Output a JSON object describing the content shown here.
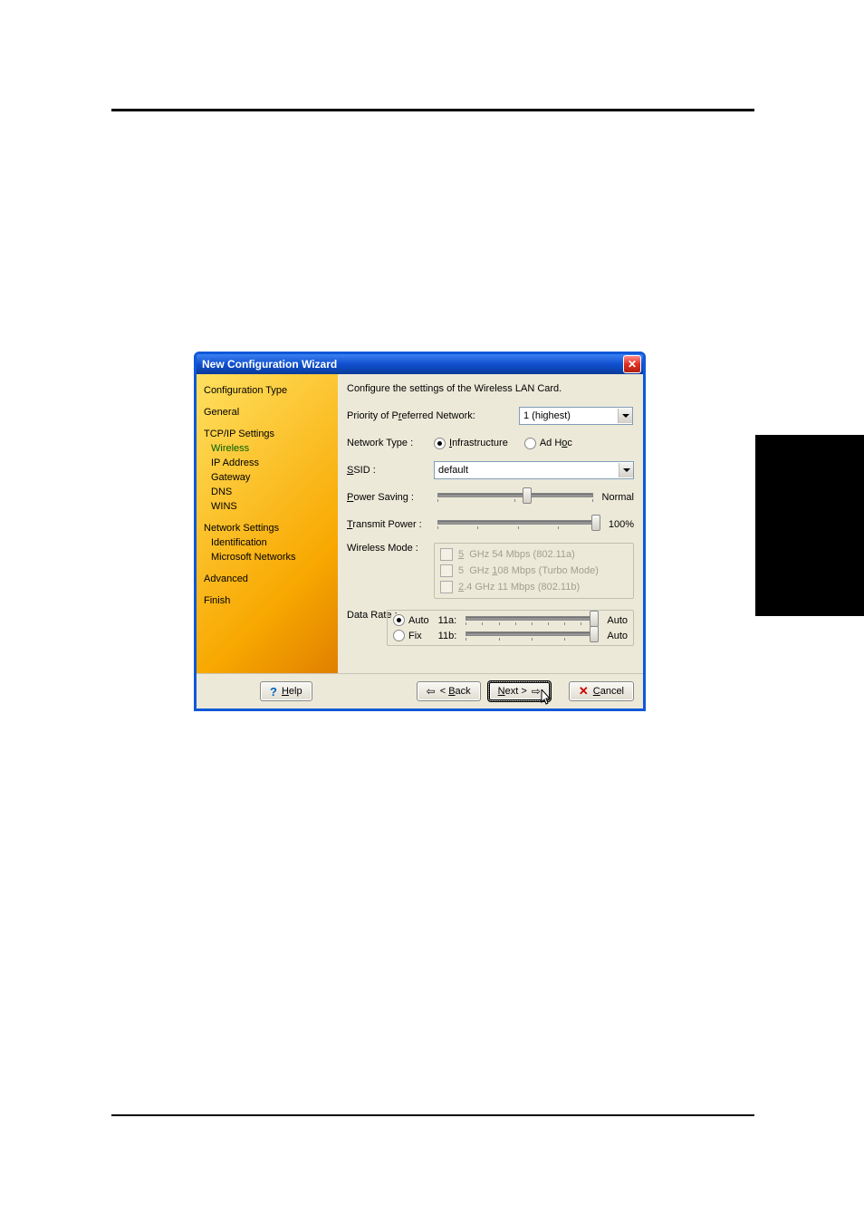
{
  "titlebar": {
    "title": "New Configuration Wizard"
  },
  "sidebar": {
    "config_type": "Configuration Type",
    "general": "General",
    "tcpip": "TCP/IP Settings",
    "wireless": "Wireless",
    "ip_address": "IP Address",
    "gateway": "Gateway",
    "dns": "DNS",
    "wins": "WINS",
    "network_settings": "Network Settings",
    "identification": "Identification",
    "ms_networks": "Microsoft Networks",
    "advanced": "Advanced",
    "finish": "Finish"
  },
  "main": {
    "description": "Configure the settings of the Wireless LAN Card.",
    "priority_label": "Priority of Preferred Network:",
    "priority_value": "1 (highest)",
    "network_type_label": "Network Type :",
    "infrastructure": "Infrastructure",
    "adhoc": "Ad Hoc",
    "ssid_label": "SSID :",
    "ssid_value": "default",
    "power_saving_label": "Power Saving :",
    "power_saving_value": "Normal",
    "transmit_power_label": "Transmit Power :",
    "transmit_power_value": "100%",
    "wireless_mode_label": "Wireless Mode :",
    "mode_5_54": "5  GHz 54 Mbps (802.11a)",
    "mode_5_108": "5  GHz 108 Mbps (Turbo Mode)",
    "mode_24_11": "2.4 GHz 11 Mbps (802.11b)",
    "data_rate_label": "Data Rate :",
    "auto": "Auto",
    "fix": "Fix",
    "dr_11a": "11a:",
    "dr_11b": "11b:",
    "dr_auto_val": "Auto"
  },
  "footer": {
    "help": "Help",
    "back": "< Back",
    "next": "Next >",
    "cancel": "Cancel"
  }
}
